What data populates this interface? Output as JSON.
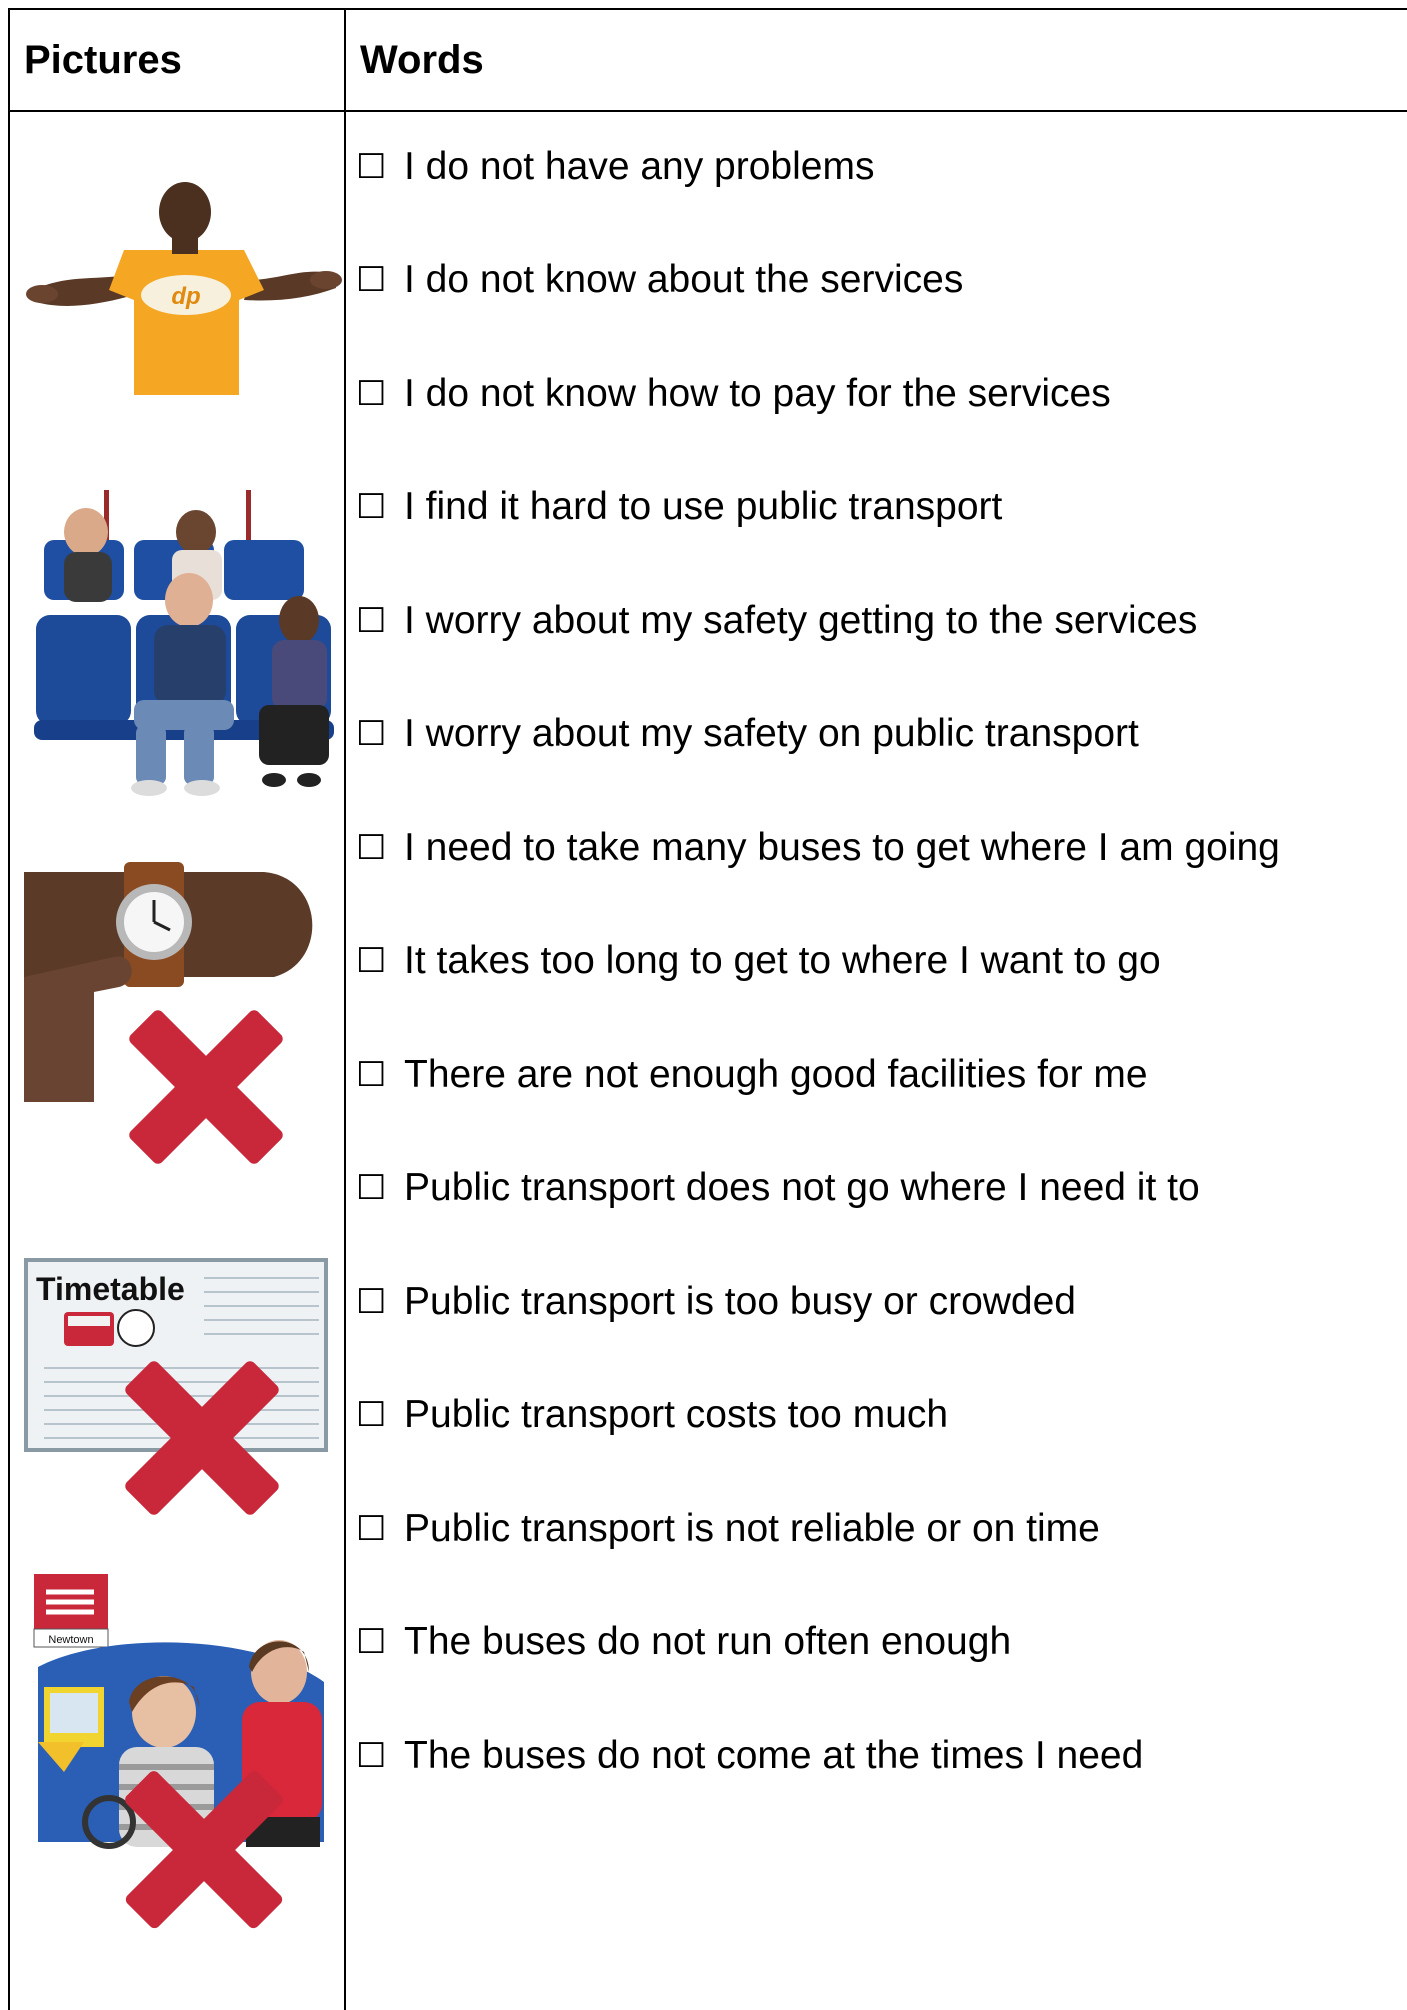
{
  "table": {
    "header_pictures": "Pictures",
    "header_words": "Words"
  },
  "checkbox_glyph": "☐",
  "options": [
    "I do not have any problems",
    "I do not know about the services",
    "I do not know how to pay for the services",
    "I find it hard to use public transport",
    "I worry about my safety getting to the services",
    "I worry about my safety on public transport",
    "I need to take many buses to get where I am going",
    "It takes too long to get to where I want to go",
    "There are not enough good facilities for me",
    "Public transport does not go where I need it to",
    "Public transport is too busy or crowded",
    "Public transport costs too much",
    "Public transport is not reliable or on time",
    "The buses do not run often enough",
    "The buses do not come at the times I need"
  ],
  "pictures": {
    "shrug_shirt_logo": "dp",
    "timetable_label": "Timetable",
    "station_sign_label": "Newtown"
  },
  "colors": {
    "cross_red": "#c8283a",
    "shirt_orange": "#f5a623",
    "seat_blue": "#1f4fa3",
    "skin_dark": "#5a3a26"
  }
}
